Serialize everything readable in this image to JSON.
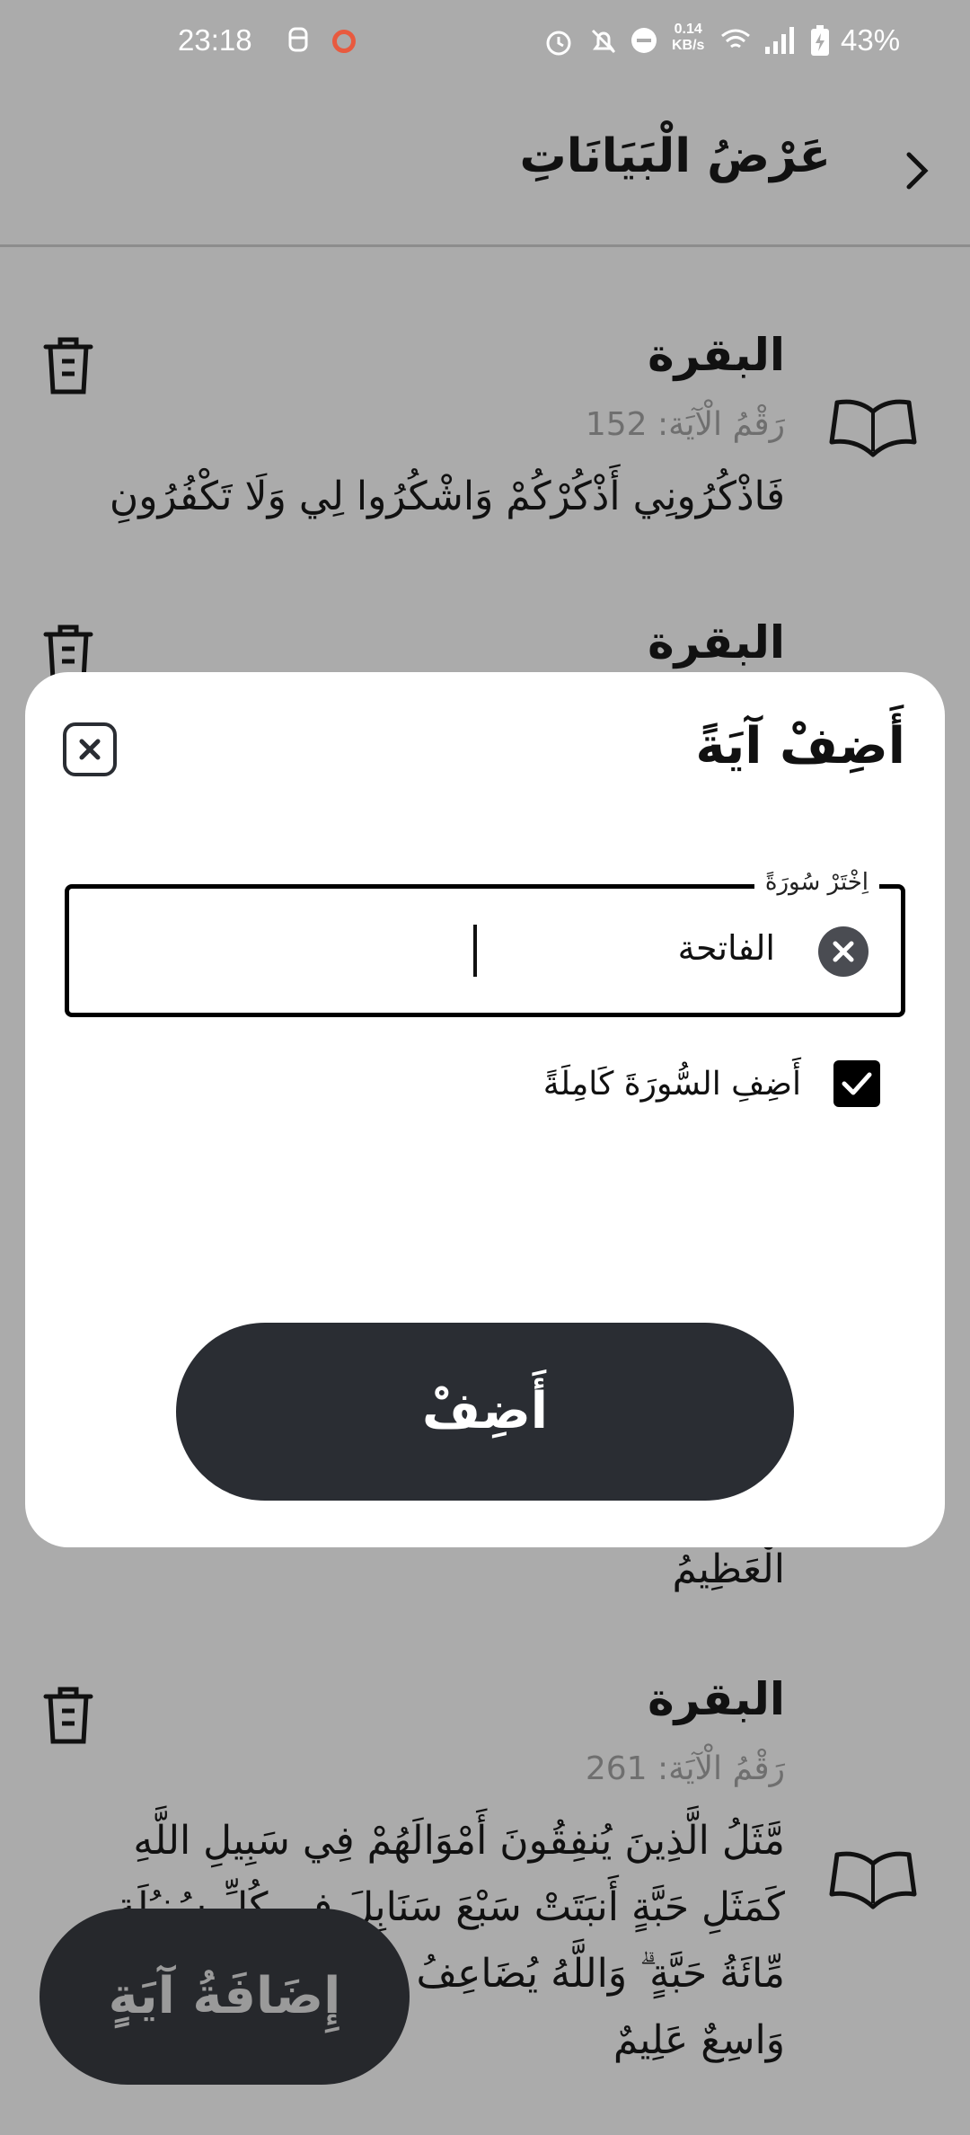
{
  "status_bar": {
    "time": "23:18",
    "net_speed_value": "0.14",
    "net_speed_unit": "KB/s",
    "battery": "43%"
  },
  "appbar": {
    "title": "عَرْضُ الْبَيَانَاتِ"
  },
  "items": [
    {
      "surah": "البقرة",
      "ayah_label": "رَقْمُ الْآيَة: 152",
      "text": "فَاذْكُرُونِي أَذْكُرْكُمْ وَاشْكُرُوا لِي وَلَا تَكْفُرُونِ"
    },
    {
      "surah": "البقرة",
      "ayah_label": "",
      "text": "الْعَظِيمُ"
    },
    {
      "surah": "البقرة",
      "ayah_label": "رَقْمُ الْآيَة: 261",
      "text": "مَّثَلُ الَّذِينَ يُنفِقُونَ أَمْوَالَهُمْ فِي سَبِيلِ اللَّهِ كَمَثَلِ حَبَّةٍ أَنبَتَتْ سَبْعَ سَنَابِلَ فِي كُلِّ سُنبُلَةٍ مِّائَةُ حَبَّةٍ ۗ وَاللَّهُ يُضَاعِفُ لِمَن يَشَاءُ ۗ وَاللَّهُ وَاسِعٌ عَلِيمٌ"
    }
  ],
  "dialog": {
    "title": "أَضِفْ آيَةً",
    "field_label": "اِخْتَرْ سُورَةً",
    "field_value": "الفاتحة",
    "checkbox_label": "أَضِفِ السُّورَةَ كَامِلَةً",
    "checkbox_checked": true,
    "add_button": "أَضِفْ"
  },
  "fab": {
    "label": "إِضَافَةُ آيَةٍ"
  }
}
